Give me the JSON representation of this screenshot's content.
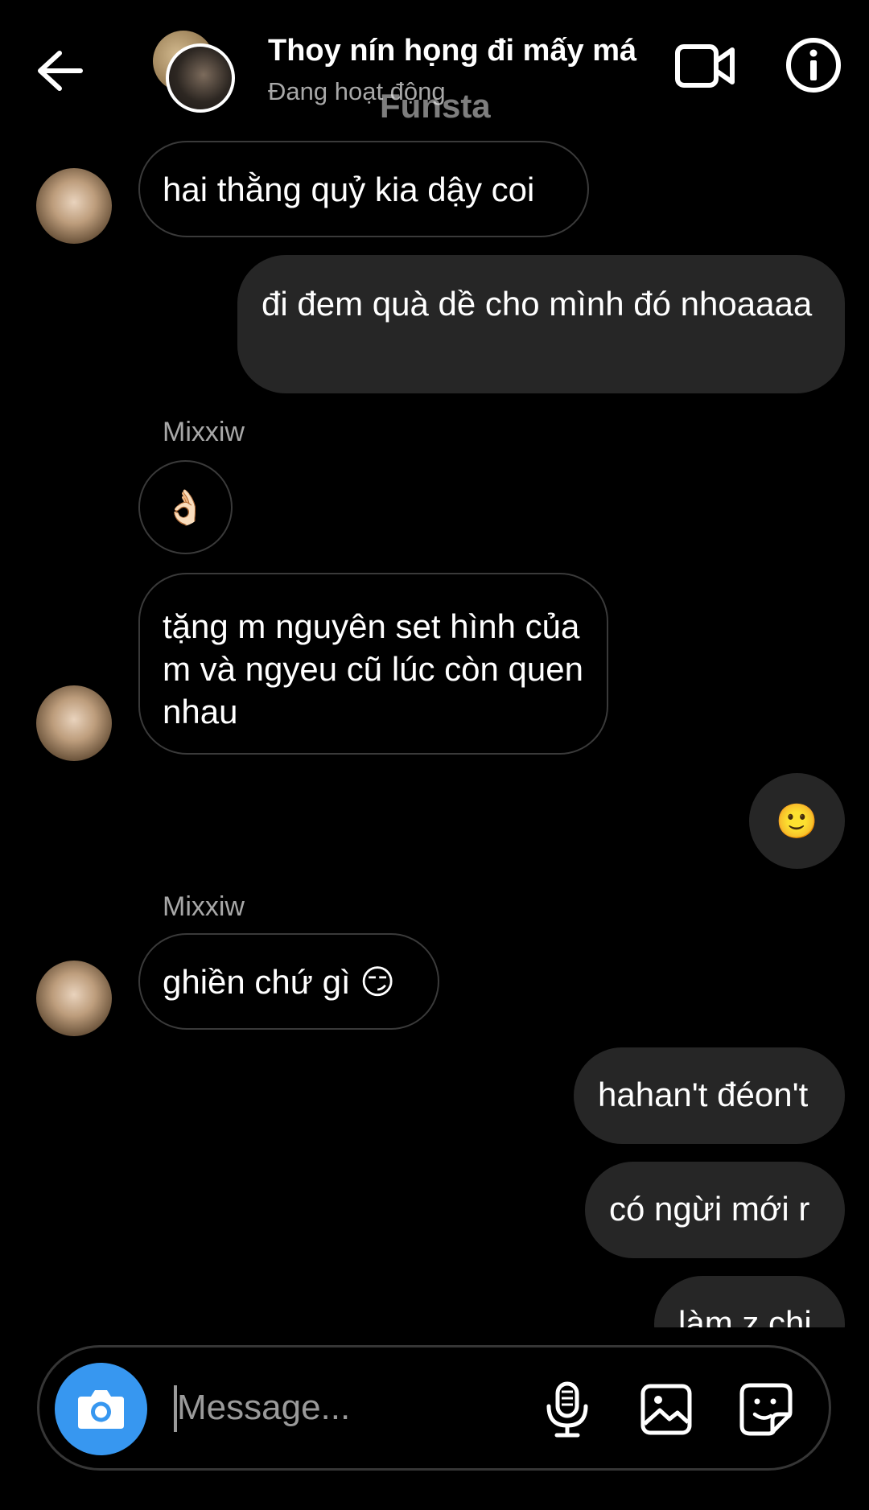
{
  "header": {
    "title": "Thoy nín họng đi mấy má",
    "status": "Đang hoạt động",
    "watermark": "Funsta",
    "icons": [
      "back-arrow-icon",
      "video-call-icon",
      "info-icon"
    ]
  },
  "messages": [
    {
      "direction": "incoming",
      "text": "hai thằng quỷ kia dậy coi"
    },
    {
      "direction": "outgoing",
      "text": "đi đem quà dề cho mình đó nhoaaaa"
    },
    {
      "direction": "incoming",
      "sender": "Mixxiw",
      "text": "👌🏻"
    },
    {
      "direction": "incoming",
      "text": "tặng m nguyên set hình của m và ngyeu cũ lúc còn quen nhau"
    },
    {
      "direction": "outgoing",
      "text": "🙂"
    },
    {
      "direction": "incoming",
      "sender": "Mixxiw",
      "text": "ghiền chứ gì",
      "emoji": "😏"
    },
    {
      "direction": "outgoing",
      "text": "hahan't đéon't"
    },
    {
      "direction": "outgoing",
      "text": "có ngừi mới r"
    },
    {
      "direction": "outgoing",
      "text": "làm z chi"
    }
  ],
  "composer": {
    "placeholder": "Message...",
    "accent_color": "#3797f0",
    "icons": [
      "camera-icon",
      "microphone-icon",
      "gallery-icon",
      "sticker-icon"
    ]
  }
}
